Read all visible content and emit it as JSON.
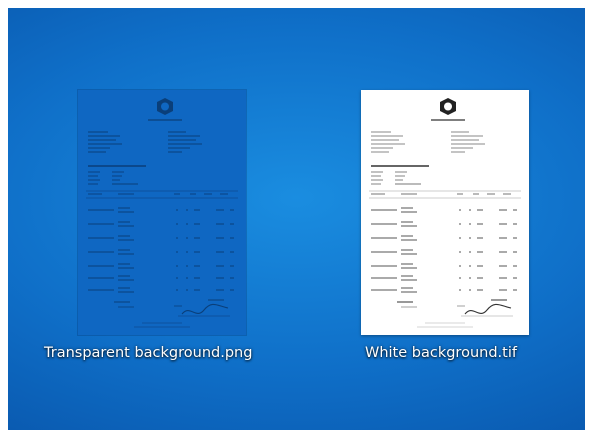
{
  "desktop": {
    "background_color": "#0f6fc8",
    "icons": [
      {
        "label": "Transparent background.png",
        "icon_name": "invoice-document-thumbnail",
        "ink_color": "#0a3f7a",
        "paper_color": "#0f67c2"
      },
      {
        "label": "White background.tif",
        "icon_name": "invoice-document-thumbnail",
        "ink_color": "#222222",
        "paper_color": "#ffffff"
      }
    ]
  }
}
